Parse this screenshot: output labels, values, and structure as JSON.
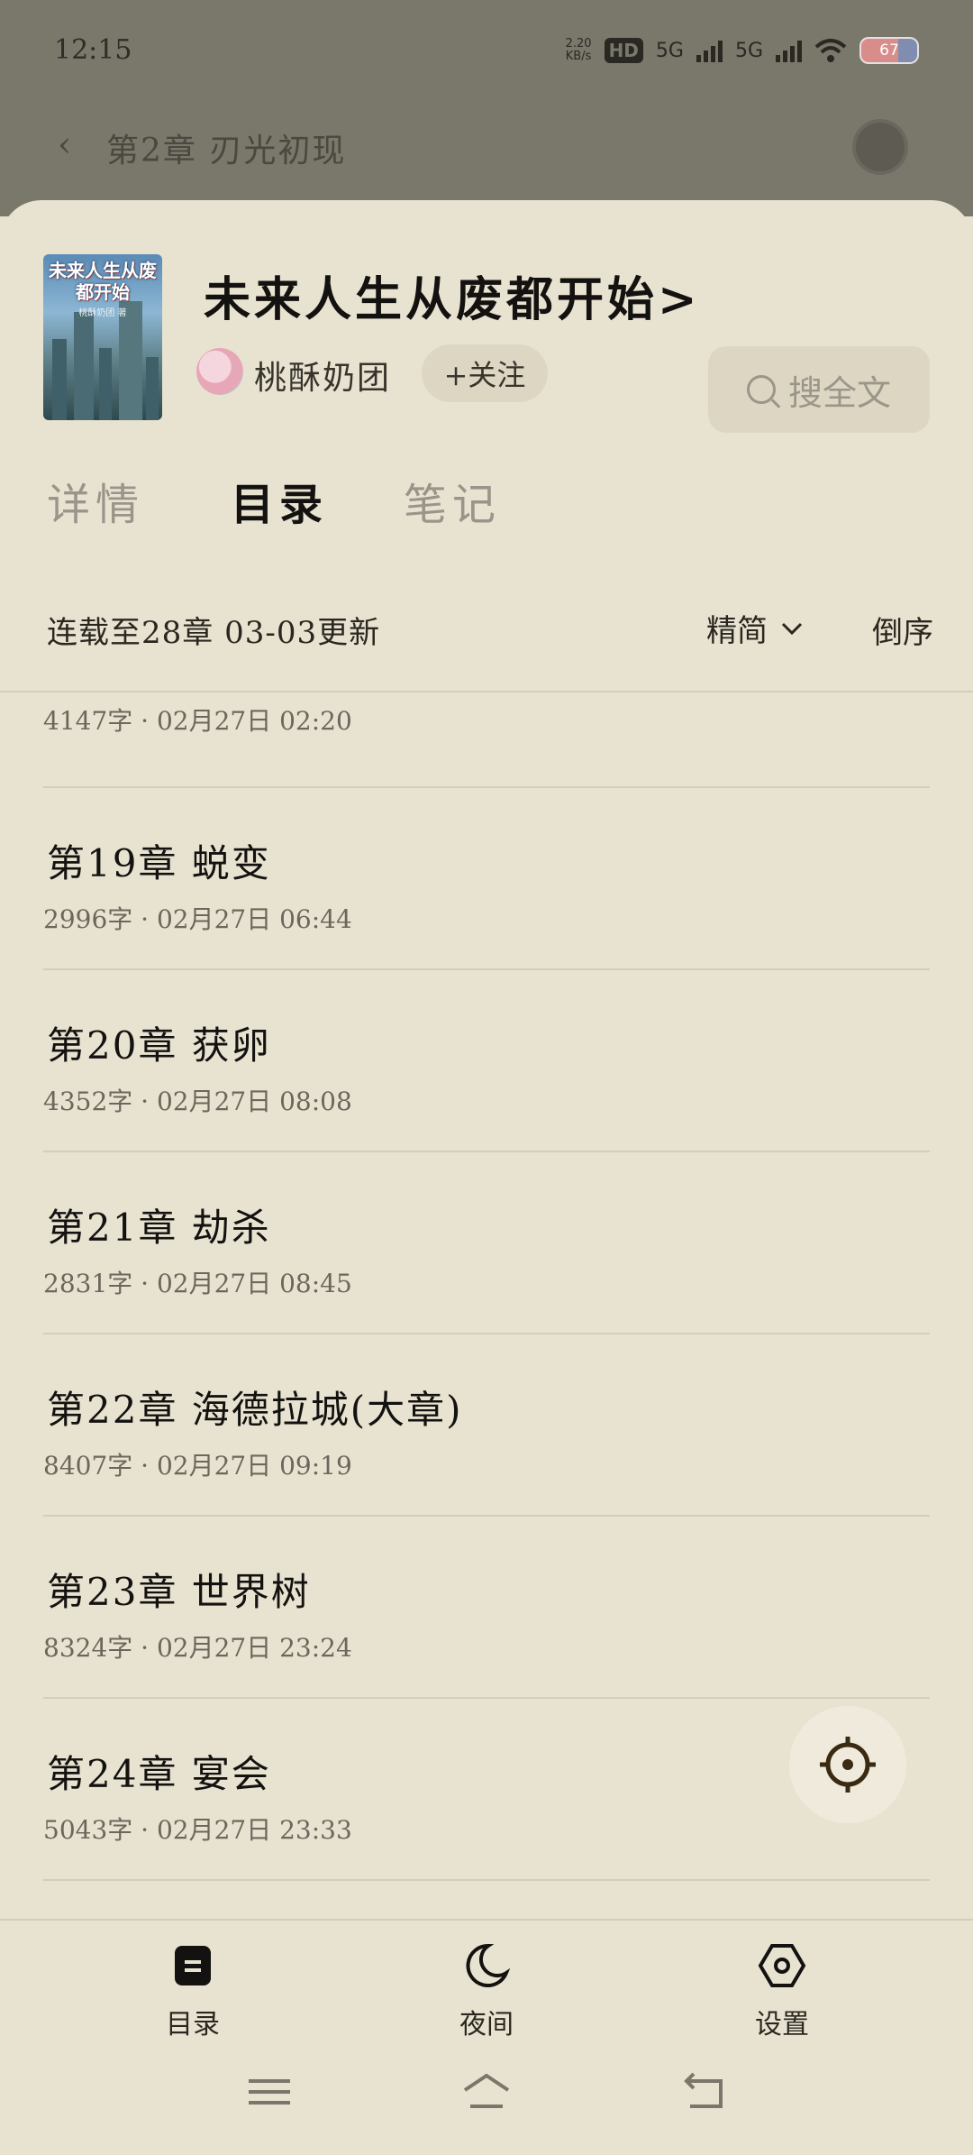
{
  "status_bar": {
    "time": "12:15",
    "net_speed_value": "2.20",
    "net_speed_unit": "KB/s",
    "hd_label": "HD",
    "sim1_label": "5G",
    "sim2_label": "5G",
    "battery": "67"
  },
  "reader": {
    "back_icon": "chevron-left-icon",
    "chapter_title": "第2章 刃光初现"
  },
  "book": {
    "cover_title": "未来人生从废都开始",
    "cover_author": "桃酥奶团 著",
    "title": "未来人生从废都开始>",
    "author": "桃酥奶团",
    "follow_label": "+关注",
    "search_label": "搜全文"
  },
  "tabs": [
    {
      "label": "详情",
      "active": false
    },
    {
      "label": "目录",
      "active": true
    },
    {
      "label": "笔记",
      "active": false
    }
  ],
  "toc_header": {
    "update_info": "连载至28章 03-03更新",
    "filter_label": "精简",
    "reverse_label": "倒序"
  },
  "chapters": [
    {
      "title": "",
      "meta": "4147字 · 02月27日 02:20"
    },
    {
      "title": "第19章 蜕变",
      "meta": "2996字 · 02月27日 06:44"
    },
    {
      "title": "第20章 获卵",
      "meta": "4352字 · 02月27日 08:08"
    },
    {
      "title": "第21章 劫杀",
      "meta": "2831字 · 02月27日 08:45"
    },
    {
      "title": "第22章 海德拉城(大章)",
      "meta": "8407字 · 02月27日 09:19"
    },
    {
      "title": "第23章 世界树",
      "meta": "8324字 · 02月27日 23:24"
    },
    {
      "title": "第24章 宴会",
      "meta": "5043字 · 02月27日 23:33"
    }
  ],
  "bottom_nav": {
    "toc": "目录",
    "night": "夜间",
    "settings": "设置"
  },
  "colors": {
    "background": "#e8e3d1",
    "dim_overlay": "#7a776b",
    "text_primary": "#141210",
    "text_secondary": "#6c675c",
    "divider": "#d3cdbb"
  }
}
